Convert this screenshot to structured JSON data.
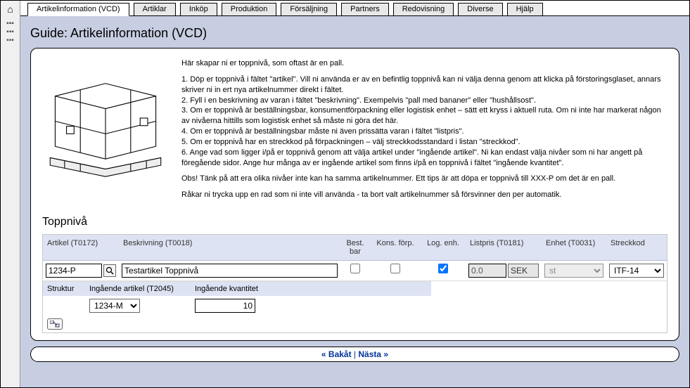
{
  "tabs": [
    {
      "label": "Artikelinformation (VCD)",
      "active": true
    },
    {
      "label": "Artiklar"
    },
    {
      "label": "Inköp"
    },
    {
      "label": "Produktion"
    },
    {
      "label": "Försäljning"
    },
    {
      "label": "Partners"
    },
    {
      "label": "Redovisning"
    },
    {
      "label": "Diverse"
    },
    {
      "label": "Hjälp"
    }
  ],
  "title": "Guide: Artikelinformation (VCD)",
  "intro": {
    "lead": "Här skapar ni er toppnivå, som oftast är en pall.",
    "step1": "1. Döp er toppnivå i fältet \"artikel\". Vill ni använda er av en befintlig toppnivå kan ni välja denna genom att klicka på förstoringsglaset, annars skriver ni in ert nya artikelnummer direkt i fältet.",
    "step2": "2. Fyll i en beskrivning av varan i fältet \"beskrivning\". Exempelvis \"pall med bananer\" eller \"hushållsost\".",
    "step3": "3. Om er toppnivå är beställningsbar, konsumentförpackning eller logistisk enhet – sätt ett kryss i aktuell ruta. Om ni inte har markerat någon av nivåerna hittills som logistisk enhet så måste ni göra det här.",
    "step4": "4. Om er toppnivå är beställningsbar måste ni även prissätta varan i fältet \"listpris\".",
    "step5": "5. Om er toppnivå har en streckkod på förpackningen – välj streckkodsstandard i listan \"streckkod\".",
    "step6": "6. Ange vad som ligger i/på er toppnivå genom att välja artikel under \"ingående artikel\". Ni kan endast välja nivåer som ni har angett på föregående sidor. Ange hur många av er ingående artikel som finns i/på en toppnivå i fältet \"ingående kvantitet\".",
    "obs": "Obs! Tänk på att era olika nivåer inte kan ha samma artikelnummer. Ett tips är att döpa er toppnivå till XXX-P om det är en pall.",
    "tail": "Råkar ni trycka upp en rad som ni inte vill använda - ta bort valt artikelnummer så försvinner den per automatik."
  },
  "section_title": "Toppnivå",
  "headers": {
    "artikel": "Artikel (T0172)",
    "beskrivning": "Beskrivning (T0018)",
    "best": "Best. bar",
    "kons": "Kons. förp.",
    "log": "Log. enh.",
    "listpris": "Listpris (T0181)",
    "enhet": "Enhet (T0031)",
    "streckkod": "Streckkod"
  },
  "row": {
    "artikel": "1234-P",
    "beskrivning": "Testartikel Toppnivå",
    "best": false,
    "kons": false,
    "log": true,
    "listpris": "0.0",
    "currency": "SEK",
    "enhet": "st",
    "streckkod": "ITF-14"
  },
  "sub_headers": {
    "struktur": "Struktur",
    "ingaende": "Ingående artikel (T2045)",
    "kvantitet": "Ingående kvantitet"
  },
  "sub_row": {
    "artikel": "1234-M",
    "kvantitet": "10"
  },
  "nav": {
    "back": "« Bakåt",
    "sep": " | ",
    "next": "Nästa »"
  }
}
